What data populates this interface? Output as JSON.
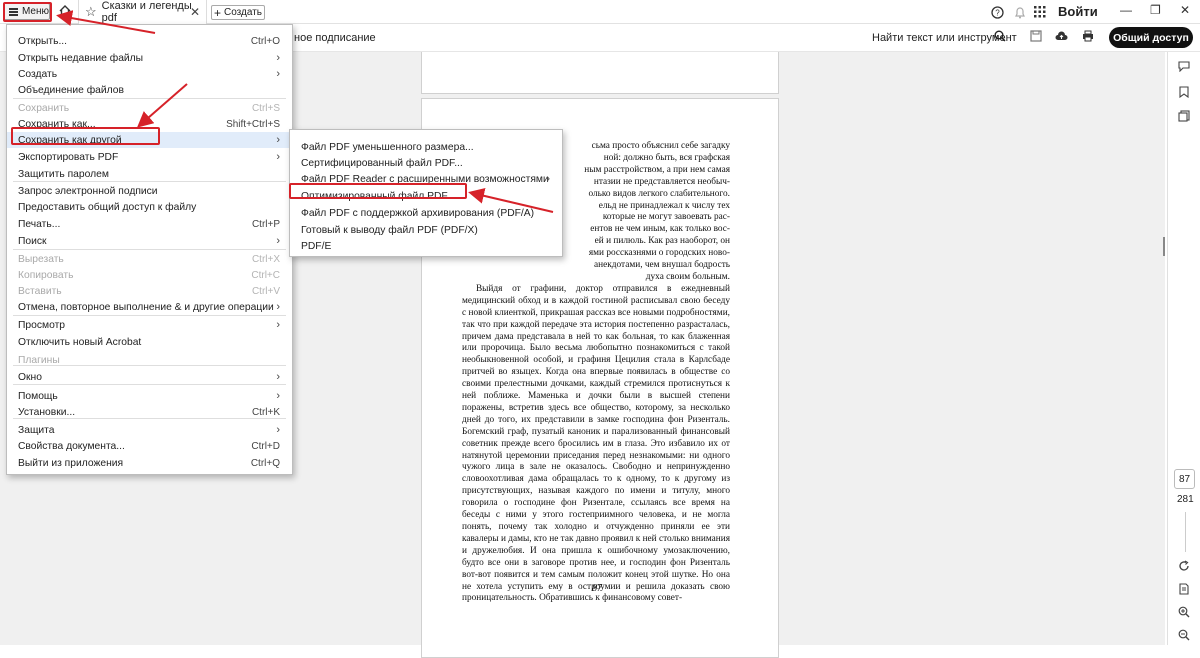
{
  "titlebar": {
    "menu_label": "Меню",
    "tab_title": "Сказки и легенды pdf",
    "create_label": "Создать",
    "login_label": "Войти"
  },
  "toolbar": {
    "partial_label": "ное подписание",
    "find_label": "Найти текст или инструмент",
    "share_label": "Общий доступ"
  },
  "menu": {
    "items": [
      {
        "label": "Открыть...",
        "shortcut": "Ctrl+O"
      },
      {
        "label": "Открыть недавние файлы",
        "shortcut": "›"
      },
      {
        "label": "Создать",
        "shortcut": "›"
      },
      {
        "label": "Объединение файлов",
        "shortcut": ""
      },
      {
        "label": "Сохранить",
        "shortcut": "Ctrl+S"
      },
      {
        "label": "Сохранить как...",
        "shortcut": "Shift+Ctrl+S"
      },
      {
        "label": "Сохранить как другой",
        "shortcut": "›"
      },
      {
        "label": "Экспортировать PDF",
        "shortcut": "›"
      },
      {
        "label": "Защитить паролем",
        "shortcut": ""
      },
      {
        "label": "Запрос электронной подписи",
        "shortcut": ""
      },
      {
        "label": "Предоставить общий доступ к файлу",
        "shortcut": ""
      },
      {
        "label": "Печать...",
        "shortcut": "Ctrl+P"
      },
      {
        "label": "Поиск",
        "shortcut": "›"
      },
      {
        "label": "Вырезать",
        "shortcut": "Ctrl+X"
      },
      {
        "label": "Копировать",
        "shortcut": "Ctrl+C"
      },
      {
        "label": "Вставить",
        "shortcut": "Ctrl+V"
      },
      {
        "label": "Отмена, повторное выполнение & и другие операции",
        "shortcut": "›"
      },
      {
        "label": "Просмотр",
        "shortcut": "›"
      },
      {
        "label": "Отключить новый Acrobat",
        "shortcut": ""
      },
      {
        "label": "Плагины",
        "shortcut": ""
      },
      {
        "label": "Окно",
        "shortcut": "›"
      },
      {
        "label": "Помощь",
        "shortcut": "›"
      },
      {
        "label": "Установки...",
        "shortcut": "Ctrl+K"
      },
      {
        "label": "Защита",
        "shortcut": "›"
      },
      {
        "label": "Свойства документа...",
        "shortcut": "Ctrl+D"
      },
      {
        "label": "Выйти из приложения",
        "shortcut": "Ctrl+Q"
      }
    ]
  },
  "submenu": {
    "items": [
      {
        "label": "Файл PDF уменьшенного размера...",
        "arrow": ""
      },
      {
        "label": "Сертифицированный файл PDF...",
        "arrow": ""
      },
      {
        "label": "Файл PDF Reader с расширенными возможностями",
        "arrow": "›"
      },
      {
        "label": "Оптимизированный файл PDF...",
        "arrow": ""
      },
      {
        "label": "Файл PDF с поддержкой архивирования (PDF/A)",
        "arrow": ""
      },
      {
        "label": "Готовый к выводу файл PDF (PDF/X)",
        "arrow": ""
      },
      {
        "label": "PDF/E",
        "arrow": ""
      }
    ]
  },
  "document": {
    "lines_top": [
      "сьма просто объяснил себе загадку",
      "ной: должно быть, вся графская",
      "ным расстройством, а при нем самая",
      "нтазии не представляется необыч-",
      "олько видов легкого слабительного.",
      "ельд не принадлежал к числу тех",
      "которые не могут завоевать рас-",
      "ентов не чем иным, как только вос-",
      "ей и пилюль. Как раз наоборот, он",
      "ями россказнями о городских ново-",
      "анекдотами, чем внушал бодрость",
      "духа своим больным."
    ],
    "paragraph": "Выйдя от графини, доктор отправился в ежедневный медицинский обход и в каждой гостиной расписывал свою беседу с новой клиенткой, прикрашая рассказ все новыми подробностями, так что при каждой передаче эта история постепенно разрасталась, причем дама представала в ней то как больная, то как блаженная или пророчица. Было весьма любопытно познакомиться с такой необыкновенной особой, и графиня Цецилия стала в Карлсбаде притчей во языцех. Когда она впервые появилась в обществе со своими прелестными дочками, каждый стремился протиснуться к ней поближе. Маменька и дочки были в высшей степени поражены, встретив здесь все общество, которому, за несколько дней до того, их представили в замке господина фон Ризенталь. Богемский граф, пузатый каноник и парализованный финансовый советник прежде всего бросились им в глаза. Это избавило их от натянутой церемонии приседания перед незнакомыми: ни одного чужого лица в зале не оказалось. Свободно и непринужденно словоохотливая дама обращалась то к одному, то к другому из присутствующих, называя каждого по имени и титулу, много говорила о господине фон Ризентале, ссылаясь все время на беседы с ними у этого гостеприимного человека, и не могла понять, почему так холодно и отчужденно приняли ее эти кавалеры и дамы, кто не так давно проявил к ней столько внимания и дружелюбия. И она пришла к ошибочному умозаключению, будто все они в заговоре против нее, и господин фон Ризенталь вот-вот появится и тем самым положит конец этой шутке. Но она не хотела уступить ему в остроумии и решила доказать свою проницательность. Обратившись к финансовому совет-",
    "page_number": "87"
  },
  "pagination": {
    "current": "87",
    "total": "281"
  },
  "colors": {
    "highlight_red": "#d62229",
    "menu_active_bg": "#e1ecfa",
    "share_button_bg": "#111111"
  }
}
